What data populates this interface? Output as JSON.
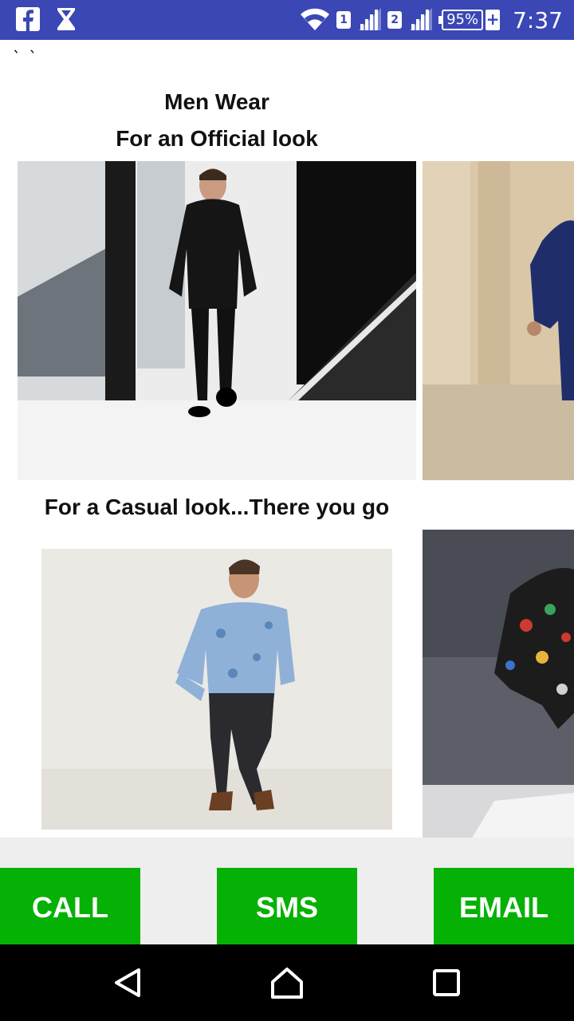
{
  "status_bar": {
    "time": "7:37",
    "battery": "95%",
    "sim1": "1",
    "sim2": "2",
    "icons": [
      "facebook-icon",
      "hourglass-icon",
      "wifi-icon",
      "signal-icon",
      "battery-icon"
    ]
  },
  "content": {
    "ticks": "` `",
    "title": "Men Wear",
    "official_caption": "For an Official look",
    "casual_caption": "For a Casual look...There you go"
  },
  "actions": {
    "call_label": "CALL",
    "sms_label": "SMS",
    "email_label": "EMAIL"
  },
  "nav": {
    "icons": [
      "back-icon",
      "home-icon",
      "recents-icon"
    ]
  },
  "colors": {
    "status_bar": "#3a47b5",
    "action_green": "#06b106",
    "action_bar_bg": "#eeeeee",
    "nav_bar": "#000000"
  }
}
